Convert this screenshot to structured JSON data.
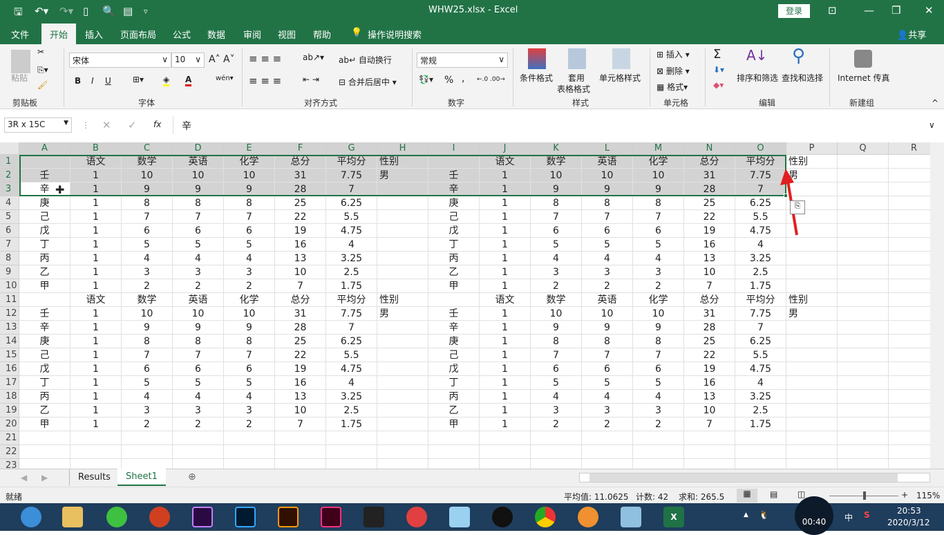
{
  "title": {
    "filename": "WHW25.xlsx  -  Excel",
    "login": "登录",
    "qa_icons": [
      "save-icon",
      "undo-icon",
      "redo-icon",
      "new-icon",
      "print-preview-icon",
      "form-icon",
      "customize-icon"
    ]
  },
  "tabs": [
    "文件",
    "开始",
    "插入",
    "页面布局",
    "公式",
    "数据",
    "审阅",
    "视图",
    "帮助"
  ],
  "tell_me": "操作说明搜索",
  "share": "共享",
  "ribbon": {
    "clipboard": {
      "paste": "粘贴",
      "group": "剪贴板"
    },
    "font": {
      "name": "宋体",
      "size": "10",
      "group": "字体",
      "bold": "B",
      "italic": "I",
      "underline": "U",
      "font_color": "#e00000",
      "fill_color": "#ffff00"
    },
    "align": {
      "wrap": "自动换行",
      "merge": "合并后居中",
      "group": "对齐方式"
    },
    "number": {
      "format": "常规",
      "percent": "%",
      "comma": ",",
      "group": "数字"
    },
    "styles": {
      "cond": "条件格式",
      "table1": "套用",
      "table2": "表格格式",
      "cell": "单元格样式",
      "group": "样式"
    },
    "cells": {
      "insert": "插入",
      "delete": "删除",
      "format": "格式",
      "group": "单元格"
    },
    "edit": {
      "sort": "排序和筛选",
      "find": "查找和选择",
      "group": "编辑",
      "sum": "Σ"
    },
    "newgroup": {
      "fax": "Internet 传真",
      "group": "新建组"
    }
  },
  "formula_bar": {
    "name_box": "3R x 15C",
    "fx": "fx",
    "value": "辛"
  },
  "columns": [
    "A",
    "B",
    "C",
    "D",
    "E",
    "F",
    "G",
    "H",
    "I",
    "J",
    "K",
    "L",
    "M",
    "N",
    "O",
    "P",
    "Q",
    "R"
  ],
  "rows": [
    [
      "",
      "语文",
      "数学",
      "英语",
      "化学",
      "总分",
      "平均分",
      "性别",
      "",
      "语文",
      "数学",
      "英语",
      "化学",
      "总分",
      "平均分",
      "性别"
    ],
    [
      "壬",
      "1",
      "10",
      "10",
      "10",
      "31",
      "7.75",
      "男",
      "壬",
      "1",
      "10",
      "10",
      "10",
      "31",
      "7.75",
      "男"
    ],
    [
      "辛",
      "1",
      "9",
      "9",
      "9",
      "28",
      "7",
      "",
      "辛",
      "1",
      "9",
      "9",
      "9",
      "28",
      "7",
      ""
    ],
    [
      "庚",
      "1",
      "8",
      "8",
      "8",
      "25",
      "6.25",
      "",
      "庚",
      "1",
      "8",
      "8",
      "8",
      "25",
      "6.25",
      ""
    ],
    [
      "己",
      "1",
      "7",
      "7",
      "7",
      "22",
      "5.5",
      "",
      "己",
      "1",
      "7",
      "7",
      "7",
      "22",
      "5.5",
      ""
    ],
    [
      "戊",
      "1",
      "6",
      "6",
      "6",
      "19",
      "4.75",
      "",
      "戊",
      "1",
      "6",
      "6",
      "6",
      "19",
      "4.75",
      ""
    ],
    [
      "丁",
      "1",
      "5",
      "5",
      "5",
      "16",
      "4",
      "",
      "丁",
      "1",
      "5",
      "5",
      "5",
      "16",
      "4",
      ""
    ],
    [
      "丙",
      "1",
      "4",
      "4",
      "4",
      "13",
      "3.25",
      "",
      "丙",
      "1",
      "4",
      "4",
      "4",
      "13",
      "3.25",
      ""
    ],
    [
      "乙",
      "1",
      "3",
      "3",
      "3",
      "10",
      "2.5",
      "",
      "乙",
      "1",
      "3",
      "3",
      "3",
      "10",
      "2.5",
      ""
    ],
    [
      "甲",
      "1",
      "2",
      "2",
      "2",
      "7",
      "1.75",
      "",
      "甲",
      "1",
      "2",
      "2",
      "2",
      "7",
      "1.75",
      ""
    ],
    [
      "",
      "语文",
      "数学",
      "英语",
      "化学",
      "总分",
      "平均分",
      "性别",
      "",
      "语文",
      "数学",
      "英语",
      "化学",
      "总分",
      "平均分",
      "性别"
    ],
    [
      "壬",
      "1",
      "10",
      "10",
      "10",
      "31",
      "7.75",
      "男",
      "壬",
      "1",
      "10",
      "10",
      "10",
      "31",
      "7.75",
      "男"
    ],
    [
      "辛",
      "1",
      "9",
      "9",
      "9",
      "28",
      "7",
      "",
      "辛",
      "1",
      "9",
      "9",
      "9",
      "28",
      "7",
      ""
    ],
    [
      "庚",
      "1",
      "8",
      "8",
      "8",
      "25",
      "6.25",
      "",
      "庚",
      "1",
      "8",
      "8",
      "8",
      "25",
      "6.25",
      ""
    ],
    [
      "己",
      "1",
      "7",
      "7",
      "7",
      "22",
      "5.5",
      "",
      "己",
      "1",
      "7",
      "7",
      "7",
      "22",
      "5.5",
      ""
    ],
    [
      "戊",
      "1",
      "6",
      "6",
      "6",
      "19",
      "4.75",
      "",
      "戊",
      "1",
      "6",
      "6",
      "6",
      "19",
      "4.75",
      ""
    ],
    [
      "丁",
      "1",
      "5",
      "5",
      "5",
      "16",
      "4",
      "",
      "丁",
      "1",
      "5",
      "5",
      "5",
      "16",
      "4",
      ""
    ],
    [
      "丙",
      "1",
      "4",
      "4",
      "4",
      "13",
      "3.25",
      "",
      "丙",
      "1",
      "4",
      "4",
      "4",
      "13",
      "3.25",
      ""
    ],
    [
      "乙",
      "1",
      "3",
      "3",
      "3",
      "10",
      "2.5",
      "",
      "乙",
      "1",
      "3",
      "3",
      "3",
      "10",
      "2.5",
      ""
    ],
    [
      "甲",
      "1",
      "2",
      "2",
      "2",
      "7",
      "1.75",
      "",
      "甲",
      "1",
      "2",
      "2",
      "2",
      "7",
      "1.75",
      ""
    ],
    [],
    [],
    []
  ],
  "row_numbers": [
    "1",
    "2",
    "3",
    "4",
    "5",
    "6",
    "7",
    "8",
    "9",
    "10",
    "11",
    "12",
    "13",
    "14",
    "15",
    "16",
    "17",
    "18",
    "19",
    "20",
    "21",
    "22",
    "23"
  ],
  "sheets": [
    "Results",
    "Sheet1"
  ],
  "active_sheet": "Sheet1",
  "status": {
    "ready": "就绪",
    "average": "平均值: 11.0625",
    "count": "计数: 42",
    "sum": "求和: 265.5",
    "zoom": "115%",
    "zoom_percent": 115
  },
  "taskbar": {
    "time": "20:53",
    "date": "2020/3/12",
    "ime": "中",
    "recording": "00:40"
  },
  "colors": {
    "excel_green": "#217346",
    "selection": "#d3d3d3",
    "arrow": "#e02020"
  }
}
